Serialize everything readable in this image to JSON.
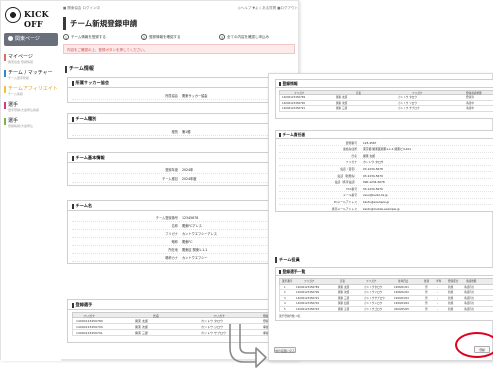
{
  "app": {
    "logo": "KICK OFF",
    "mypage": "関東ページ"
  },
  "sidebar": {
    "items": [
      {
        "label": "マイページ",
        "sub": "関東協会 登録情報",
        "color": "#d86d6d"
      },
      {
        "label": "チーム / マッチャー",
        "sub": "チーム選手登録",
        "color": "#3a82c8"
      },
      {
        "label": "チームアフィリエイト",
        "sub": "チーム情報",
        "color": "#f2bf45"
      },
      {
        "label": "選手",
        "sub": "選手登録/大会申込情報",
        "color": "#c94080"
      },
      {
        "label": "選手",
        "sub": "登録情報/大会申込",
        "color": "#7eb050"
      }
    ]
  },
  "topbar": {
    "left": "■ 関東協会 ログイン中",
    "right": "◎ヘルプ ▼よくある質問 ■ログアウト"
  },
  "page": {
    "title": "チーム新規登録申請"
  },
  "steps": [
    {
      "num": "1",
      "label": "チーム情報を登録する"
    },
    {
      "num": "2",
      "label": "登録情報を確認する"
    },
    {
      "num": "3",
      "label": "全ての内容を確認し申込み"
    }
  ],
  "alert": "内容をご確認の上、登録ボタンを押してください。",
  "team_info_heading": "チーム情報",
  "sec_assoc": {
    "title": "所属サッカー協会",
    "rows": [
      {
        "k": "所属協会",
        "v": "関東サッカー協会"
      }
    ]
  },
  "sec_category": {
    "title": "チーム種別",
    "rows": [
      {
        "k": "種別",
        "v": "第1種"
      }
    ]
  },
  "sec_basic": {
    "title": "チーム基本情報",
    "rows": [
      {
        "k": "登録年度",
        "v": "2024年"
      },
      {
        "k": "チーム種目",
        "v": "2024年度"
      }
    ]
  },
  "sec_team": {
    "title": "チーム名",
    "rows": [
      {
        "k": "チーム登録番号",
        "v": "12345678"
      },
      {
        "k": "名称",
        "v": "関東FCアレス"
      },
      {
        "k": "フリガナ",
        "v": "カントウエフシーアレス"
      },
      {
        "k": "略称",
        "v": "関東FC"
      },
      {
        "k": "所在地",
        "v": "関東区 関東1-1-1"
      },
      {
        "k": "略称カナ",
        "v": "カントウエフシー"
      }
    ]
  },
  "sec_staff": {
    "title": "登録選手",
    "headers": [
      "フリガナ",
      "氏名",
      "フリガナ",
      "登録承認状態"
    ],
    "rows": [
      [
        "14000123456789",
        "関東 太郎",
        "カントウ タロウ",
        "登録済"
      ],
      [
        "14000123456790",
        "関東 次郎",
        "カントウ ジロウ",
        "承認中"
      ],
      [
        "14000123456791",
        "関東 三郎",
        "カントウ サブロウ",
        "承認中"
      ]
    ]
  },
  "s2": {
    "block1": {
      "title": "登録情報",
      "headers": [
        "フリガナ",
        "氏名",
        "フリガナ",
        "登録承認状態"
      ],
      "rows": [
        [
          "14000123456789",
          "関東 太郎",
          "カントウ タロウ",
          "登録済"
        ],
        [
          "14000123456790",
          "関東 次郎",
          "カントウ ジロウ",
          "承認中"
        ],
        [
          "14000123456791",
          "関東 三郎",
          "カントウ サブロウ",
          "承認中"
        ]
      ]
    },
    "block2": {
      "title": "チーム責任者",
      "rows": [
        {
          "k": "郵便番号",
          "v": "123-4567"
        },
        {
          "k": "連絡先住所",
          "v": "東京都 関東区関東1-1-1 関東ビル101"
        },
        {
          "k": "氏名",
          "v": "関東 太郎"
        },
        {
          "k": "フリガナ",
          "v": "カントウ タロウ"
        },
        {
          "k": "電話（自宅）",
          "v": "03-1234-5678"
        },
        {
          "k": "電話（勤務先）",
          "v": "03-1234-5679"
        },
        {
          "k": "電話（携帯電話）",
          "v": "090-1234-5678"
        },
        {
          "k": "FAX番号",
          "v": "03-1234-5670"
        },
        {
          "k": "メール番号",
          "v": "xxxx@kanto-fa.jp"
        },
        {
          "k": "PCメールアドレス",
          "v": "kanto@example.jp"
        },
        {
          "k": "携帯メールアドレス",
          "v": "kanto@mobile.example.jp"
        }
      ]
    },
    "staff_heading": "チーム役員",
    "block3": {
      "title": "登録選手一覧",
      "headers": [
        "選手番号",
        "フリガナ",
        "氏名",
        "フリガナ",
        "生年月日",
        "性別",
        "学年",
        "登録区分",
        "承認状態"
      ],
      "rows": [
        [
          "1",
          "14000123456789",
          "関東 太郎",
          "カントウタロウ",
          "1998/01/01",
          "男",
          "-",
          "新規",
          "承認待ち"
        ],
        [
          "2",
          "14000123456790",
          "関東 次郎",
          "カントウジロウ",
          "1998/02/02",
          "男",
          "-",
          "新規",
          "承認待ち"
        ],
        [
          "3",
          "14000123456791",
          "関東 三郎",
          "カントウサブロウ",
          "1999/03/03",
          "男",
          "-",
          "新規",
          "承認待ち"
        ],
        [
          "4",
          "14000123456792",
          "関東 四郎",
          "カントウシロウ",
          "1999/04/04",
          "男",
          "-",
          "新規",
          "承認待ち"
        ],
        [
          "5",
          "14000123456793",
          "関東 五郎",
          "カントウゴロウ",
          "2000/05/05",
          "男",
          "-",
          "新規",
          "承認待ち"
        ]
      ],
      "count": "選手登録件数: 5名"
    },
    "back_label": "前の画面に戻る",
    "register_label": "登録"
  }
}
